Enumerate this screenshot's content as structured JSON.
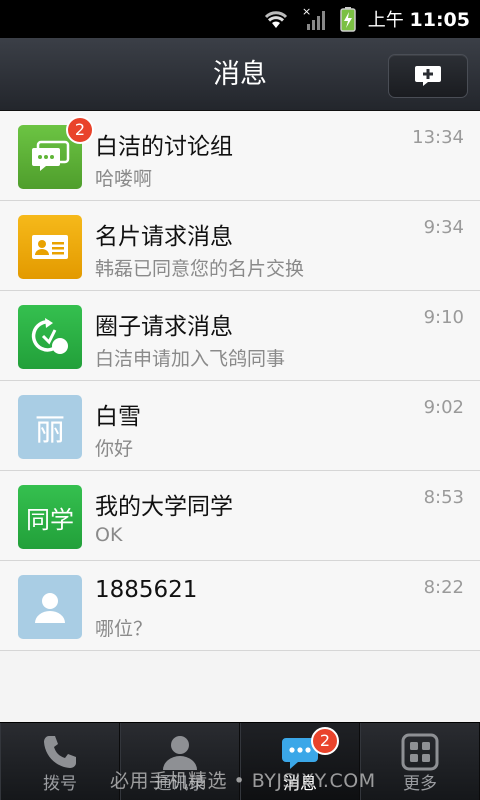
{
  "status_bar": {
    "time_prefix": "上午",
    "time": "11:05"
  },
  "header": {
    "title": "消息",
    "compose_icon": "add-message-icon"
  },
  "conversations": [
    {
      "name": "白洁的讨论组",
      "preview": "哈喽啊",
      "time": "13:34",
      "badge": "2",
      "avatar": "discussion-group-icon",
      "color": "#5fb537"
    },
    {
      "name": "名片请求消息",
      "preview": "韩磊已同意您的名片交换",
      "time": "9:34",
      "avatar": "business-card-icon",
      "color": "#f0a800"
    },
    {
      "name": "圈子请求消息",
      "preview": "白洁申请加入飞鸽同事",
      "time": "9:10",
      "avatar": "circle-request-icon",
      "color": "#2eb346"
    },
    {
      "name": "白雪",
      "preview": "你好",
      "time": "9:02",
      "avatar_text": "丽",
      "color": "#a9cde4"
    },
    {
      "name": "我的大学同学",
      "preview": "OK",
      "time": "8:53",
      "avatar_text": "同学",
      "color": "#2eb346"
    },
    {
      "name": "1885621",
      "preview": "哪位？",
      "time": "8:22",
      "avatar": "person-icon",
      "color": "#a9cde4"
    }
  ],
  "tabs": [
    {
      "label": "拨号",
      "icon": "phone-icon"
    },
    {
      "label": "通讯录",
      "icon": "contacts-icon"
    },
    {
      "label": "消息",
      "icon": "message-icon",
      "badge": "2",
      "active": true
    },
    {
      "label": "更多",
      "icon": "more-grid-icon"
    }
  ],
  "watermark": "必用手机精选 • BYJSJXY.COM"
}
